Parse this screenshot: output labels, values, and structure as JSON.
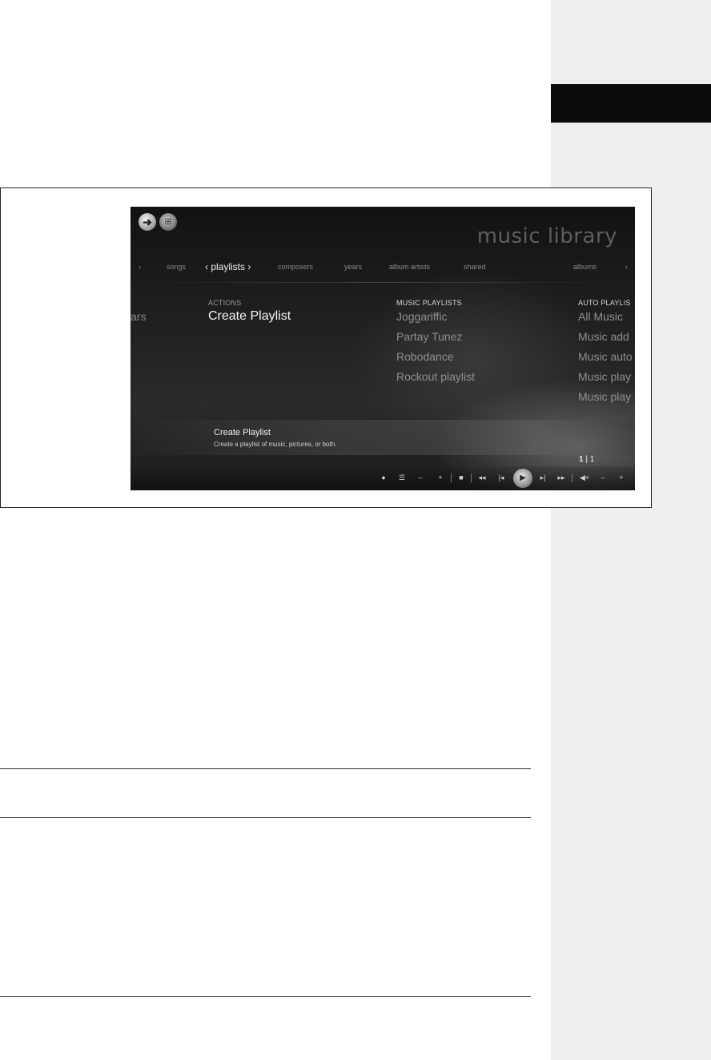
{
  "window": {
    "title": "music library",
    "back_glyph": "➜",
    "start_glyph": "⊞"
  },
  "nav": {
    "tabs": {
      "songs": "songs",
      "playlists": "‹ playlists ›",
      "composers": "composers",
      "years": "years",
      "album_artists": "album artists",
      "shared": "shared",
      "albums": "albums"
    },
    "left_arrow_glyph": "›",
    "right_arrow_glyph": "‹"
  },
  "left_partial": "ars",
  "actions": {
    "header": "ACTIONS",
    "create": "Create Playlist"
  },
  "music_playlists": {
    "header": "MUSIC PLAYLISTS",
    "items": [
      "Joggariffic",
      "Partay Tunez",
      "Robodance",
      "Rockout playlist"
    ]
  },
  "auto_playlists": {
    "header": "AUTO PLAYLIS",
    "items": [
      "All Music",
      "Music add",
      "Music auto",
      "Music play",
      "Music play"
    ]
  },
  "info": {
    "title": "Create Playlist",
    "description": "Create a playlist of music, pictures, or both."
  },
  "pager": {
    "current": "1",
    "sep": "|",
    "total": "1"
  },
  "controls": {
    "record": "●",
    "guide": "☰",
    "ch_down": "–",
    "ch_up": "+",
    "stop": "■",
    "rewind": "◂◂",
    "prev": "|◂",
    "play": "▶",
    "next": "▸|",
    "ffwd": "▸▸",
    "mute": "◀×",
    "vol_down": "–",
    "vol_up": "+"
  },
  "colors": {
    "sidebar_bg": "#efefef",
    "sidebar_tab": "#0c0c0c",
    "screen_bg": "#1e1e1e"
  }
}
